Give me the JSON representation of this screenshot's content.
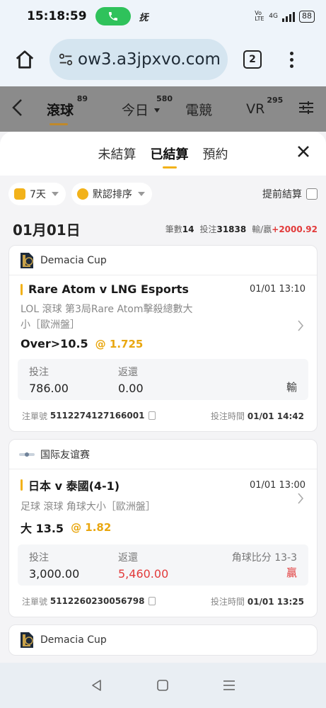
{
  "status": {
    "time": "15:18:59",
    "kk": "抚",
    "volte": "Vo LTE",
    "net": "4G",
    "battery": "88"
  },
  "browser": {
    "url": "ow3.a3jpxvo.com",
    "tab_count": "2"
  },
  "app_nav": {
    "tabs": [
      {
        "label": "滾球",
        "badge": "89"
      },
      {
        "label": "今日",
        "badge": "580"
      },
      {
        "label": "電競",
        "badge": ""
      },
      {
        "label": "VR",
        "badge": "295"
      }
    ]
  },
  "sheet": {
    "tabs": [
      "未結算",
      "已結算",
      "預約"
    ],
    "filters": {
      "range": "7天",
      "sort": "默認排序",
      "early_settle": "提前結算"
    },
    "day": {
      "date": "01月01日",
      "count_label": "筆數",
      "count": "14",
      "stake_label": "投注",
      "stake": "31838",
      "pnl_label": "輸/贏",
      "pnl": "+2000.92"
    },
    "bets": [
      {
        "league": "Demacia Cup",
        "match": "Rare Atom v LNG Esports",
        "match_time": "01/01 13:10",
        "market_line1": "LOL 滾球   第3局Rare Atom擊殺總數大",
        "market_line2": "小［歐洲盤］",
        "pick": "Over>10.5",
        "odds": "@ 1.725",
        "stake_label": "投注",
        "stake": "786.00",
        "return_label": "返還",
        "return": "0.00",
        "result_note": "",
        "result": "輸",
        "order_label": "注單號",
        "order_no": "5112274127166001",
        "bet_time_label": "投注時間",
        "bet_time": "01/01 14:42"
      },
      {
        "league": "国际友谊赛",
        "match": "日本 v 泰國(4-1)",
        "match_time": "01/01 13:00",
        "market_line1": "足球 滾球   角球大小［歐洲盤］",
        "market_line2": "",
        "pick": "大 13.5",
        "odds": "@ 1.82",
        "stake_label": "投注",
        "stake": "3,000.00",
        "return_label": "返還",
        "return": "5,460.00",
        "result_note": "角球比分 13-3",
        "result": "贏",
        "order_label": "注單號",
        "order_no": "5112260230056798",
        "bet_time_label": "投注時間",
        "bet_time": "01/01 13:25"
      }
    ],
    "next_league": "Demacia Cup"
  },
  "colors": {
    "accent": "#f2b21a",
    "loss_red": "#e23b3b",
    "call_green": "#2fc25b"
  }
}
